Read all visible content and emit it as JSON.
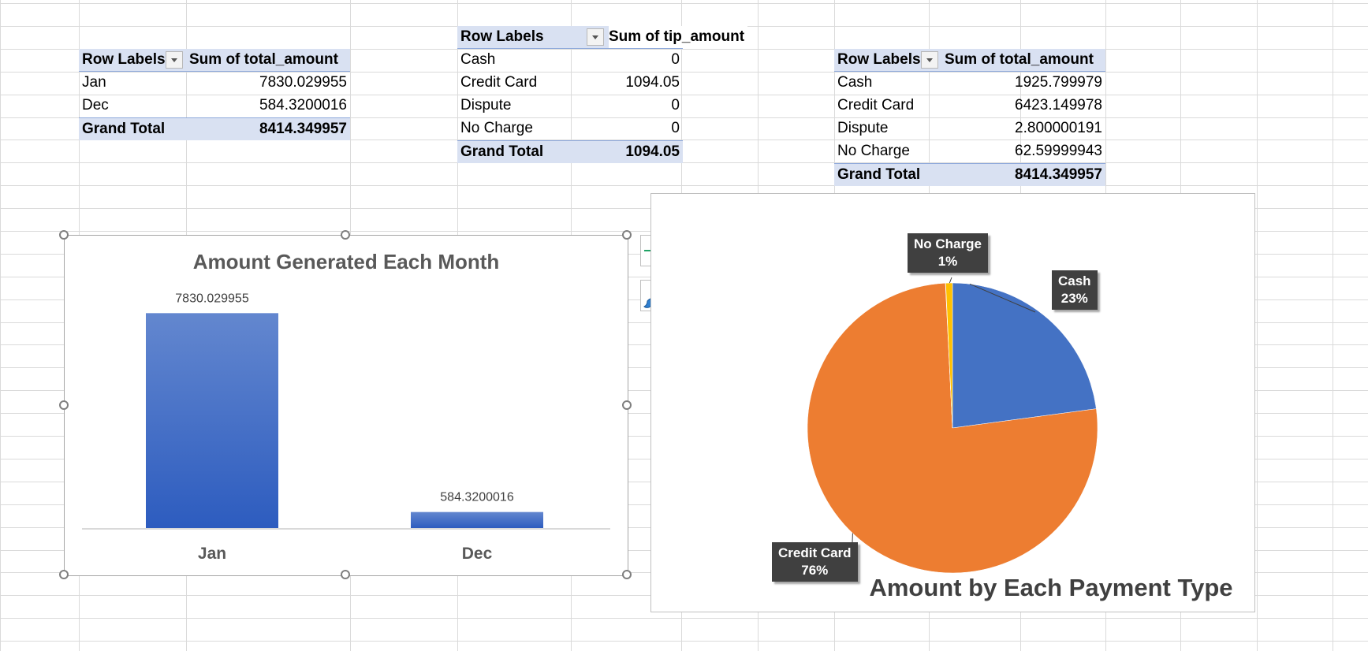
{
  "pivot_month": {
    "header": [
      "Row Labels",
      "Sum of total_amount"
    ],
    "rows": [
      {
        "label": "Jan",
        "value": "7830.029955"
      },
      {
        "label": "Dec",
        "value": "584.3200016"
      }
    ],
    "total": {
      "label": "Grand Total",
      "value": "8414.349957"
    }
  },
  "pivot_tip": {
    "header": [
      "Row Labels",
      "Sum of tip_amount"
    ],
    "rows": [
      {
        "label": "Cash",
        "value": "0"
      },
      {
        "label": "Credit Card",
        "value": "1094.05"
      },
      {
        "label": "Dispute",
        "value": "0"
      },
      {
        "label": "No Charge",
        "value": "0"
      }
    ],
    "total": {
      "label": "Grand Total",
      "value": "1094.05"
    }
  },
  "pivot_payment": {
    "header": [
      "Row Labels",
      "Sum of total_amount"
    ],
    "rows": [
      {
        "label": "Cash",
        "value": "1925.799979"
      },
      {
        "label": "Credit Card",
        "value": "6423.149978"
      },
      {
        "label": "Dispute",
        "value": "2.800000191"
      },
      {
        "label": "No Charge",
        "value": "62.59999943"
      }
    ],
    "total": {
      "label": "Grand Total",
      "value": "8414.349957"
    }
  },
  "chart_data": [
    {
      "type": "bar",
      "title": "Amount Generated Each Month",
      "categories": [
        "Jan",
        "Dec"
      ],
      "values": [
        7830.029955,
        584.3200016
      ],
      "data_labels": [
        "7830.029955",
        "584.3200016"
      ],
      "ylim": [
        0,
        8500
      ],
      "grid": false,
      "color": "#4472c4"
    },
    {
      "type": "pie",
      "title": "Amount by Each Payment Type",
      "slices": [
        {
          "name": "Cash",
          "value": 1925.799979,
          "label": "23%",
          "color": "#4472c4"
        },
        {
          "name": "Credit Card",
          "value": 6423.149978,
          "label": "76%",
          "color": "#ed7d31"
        },
        {
          "name": "Dispute",
          "value": 2.800000191,
          "label": "",
          "color": "#a5a5a5"
        },
        {
          "name": "No Charge",
          "value": 62.59999943,
          "label": "1%",
          "color": "#ffc000"
        }
      ]
    }
  ],
  "icons": {
    "chart_elements": "plus-icon",
    "chart_styles": "brush-icon"
  }
}
